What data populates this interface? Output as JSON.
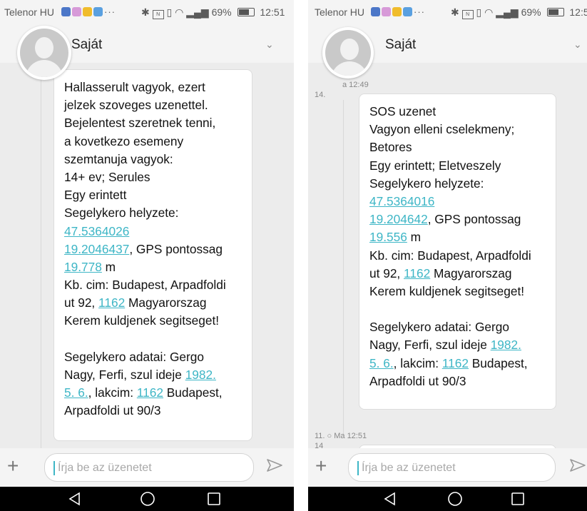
{
  "left_screen": {
    "status_bar": {
      "carrier": "Telenor HU",
      "battery": "69%",
      "time": "12:51"
    },
    "header": {
      "contact": "Saját"
    },
    "messages": [
      {
        "lines": [
          [
            {
              "t": "Hallasserult vagyok, ezert"
            }
          ],
          [
            {
              "t": "jelzek szoveges uzenettel."
            }
          ],
          [
            {
              "t": "Bejelentest szeretnek tenni,"
            }
          ],
          [
            {
              "t": "a kovetkezo esemeny"
            }
          ],
          [
            {
              "t": "szemtanuja vagyok:"
            }
          ],
          [
            {
              "t": "14+ ev; Serules"
            }
          ],
          [
            {
              "t": "Egy erintett"
            }
          ],
          [
            {
              "t": "Segelykero helyzete:"
            }
          ],
          [
            {
              "t": "47.5364026",
              "link": true
            }
          ],
          [
            {
              "t": "19.2046437",
              "link": true
            },
            {
              "t": ", GPS pontossag"
            }
          ],
          [
            {
              "t": "19.778",
              "link": true
            },
            {
              "t": " m"
            }
          ],
          [
            {
              "t": "Kb. cim: Budapest, Arpadfoldi"
            }
          ],
          [
            {
              "t": "ut 92, "
            },
            {
              "t": "1162",
              "link": true
            },
            {
              "t": " Magyarorszag"
            }
          ],
          [
            {
              "t": "Kerem kuldjenek segitseget!"
            }
          ],
          [],
          [
            {
              "t": "Segelykero adatai: Gergo"
            }
          ],
          [
            {
              "t": "Nagy, Ferfi, szul ideje "
            },
            {
              "t": "1982.",
              "link": true
            }
          ],
          [
            {
              "t": "5. 6.",
              "link": true
            },
            {
              "t": ", lakcim: "
            },
            {
              "t": "1162",
              "link": true
            },
            {
              "t": " Budapest,"
            }
          ],
          [
            {
              "t": "Arpadfoldi ut 90/3"
            }
          ]
        ]
      }
    ],
    "input": {
      "placeholder": "Írja be az üzenetet"
    }
  },
  "right_screen": {
    "status_bar": {
      "carrier": "Telenor HU",
      "battery": "69%",
      "time": "12:5"
    },
    "header": {
      "contact": "Saját"
    },
    "timestamps": {
      "first_time": "a 12:49",
      "first_num": "14.",
      "second": "11. ○ Ma 12:51",
      "second_num": "14"
    },
    "messages": [
      {
        "lines": [
          [
            {
              "t": "SOS uzenet"
            }
          ],
          [
            {
              "t": "Vagyon elleni cselekmeny;"
            }
          ],
          [
            {
              "t": "Betores"
            }
          ],
          [
            {
              "t": "Egy erintett; Eletveszely"
            }
          ],
          [
            {
              "t": "Segelykero helyzete:"
            }
          ],
          [
            {
              "t": "47.5364016",
              "link": true
            }
          ],
          [
            {
              "t": "19.204642",
              "link": true
            },
            {
              "t": ", GPS pontossag"
            }
          ],
          [
            {
              "t": "19.556",
              "link": true
            },
            {
              "t": " m"
            }
          ],
          [
            {
              "t": "Kb. cim: Budapest, Arpadfoldi"
            }
          ],
          [
            {
              "t": "ut 92, "
            },
            {
              "t": "1162",
              "link": true
            },
            {
              "t": " Magyarorszag"
            }
          ],
          [
            {
              "t": "Kerem kuldjenek segitseget!"
            }
          ],
          [],
          [
            {
              "t": "Segelykero adatai: Gergo"
            }
          ],
          [
            {
              "t": "Nagy, Ferfi, szul ideje "
            },
            {
              "t": "1982.",
              "link": true
            }
          ],
          [
            {
              "t": "5. 6.",
              "link": true
            },
            {
              "t": ", lakcim: "
            },
            {
              "t": "1162",
              "link": true
            },
            {
              "t": " Budapest,"
            }
          ],
          [
            {
              "t": "Arpadfoldi ut 90/3"
            }
          ]
        ]
      }
    ],
    "input": {
      "placeholder": "Írja be az üzenetet"
    }
  },
  "icons": {
    "notification_icons": [
      "app-icon",
      "app-icon",
      "app-icon",
      "message-icon",
      "more-dots-icon"
    ],
    "system_icons": [
      "bluetooth-icon",
      "nfc-icon",
      "vibrate-icon",
      "wifi-icon",
      "signal-icon",
      "battery-icon"
    ],
    "header": "chevron-down-icon",
    "input_bar": [
      "plus-icon",
      "send-icon"
    ],
    "nav_bar": [
      "back-icon",
      "home-icon",
      "recents-icon"
    ]
  },
  "colors": {
    "link": "#3eb6c6",
    "nav_bar": "#000000",
    "chat_background": "#ececec"
  }
}
